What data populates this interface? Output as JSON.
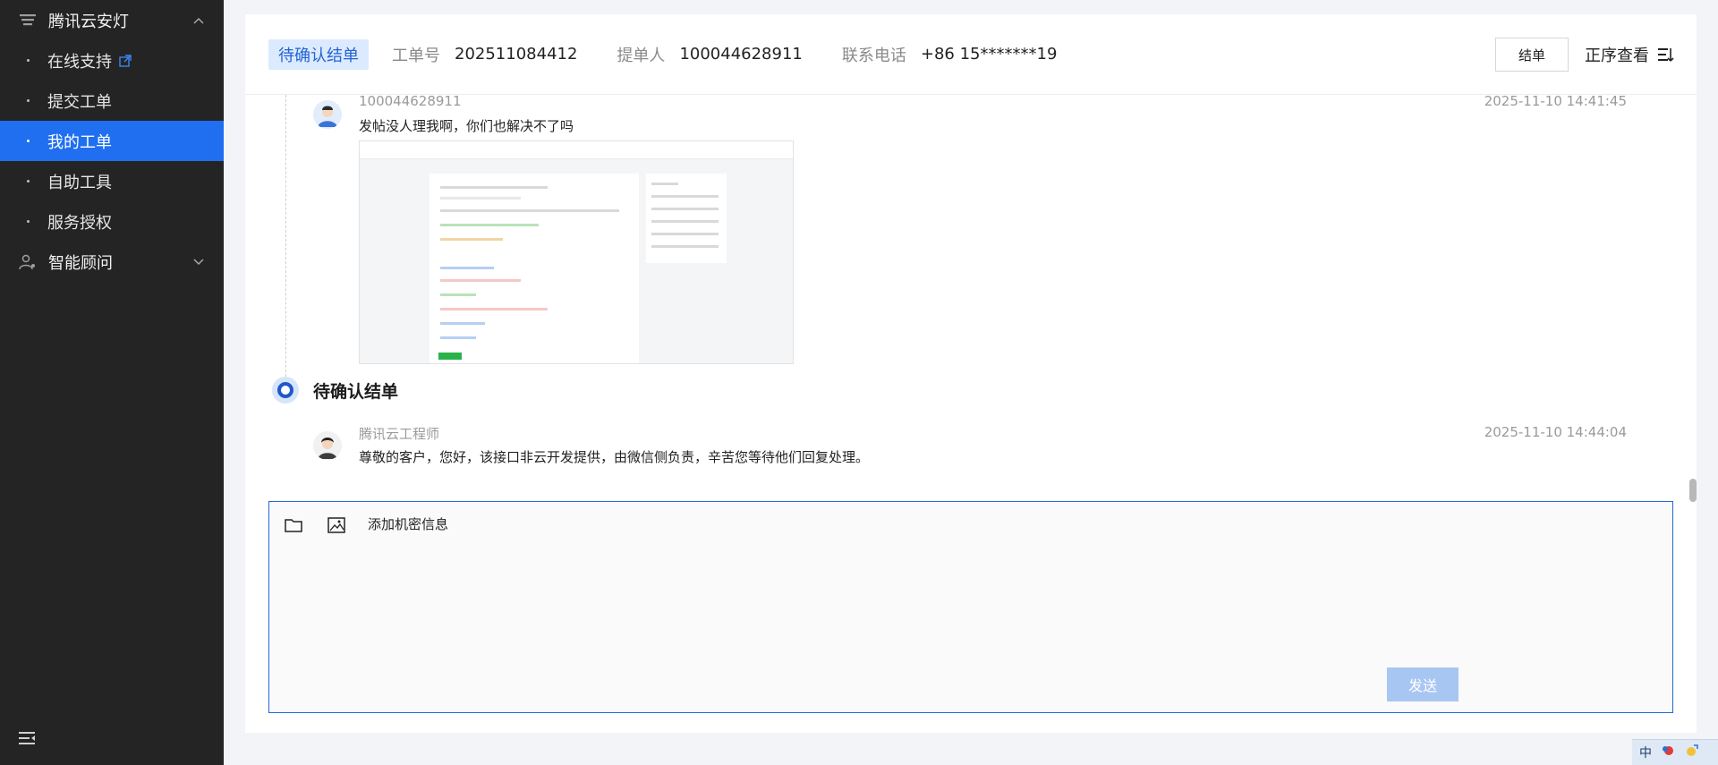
{
  "sidebar": {
    "group1": {
      "label": "腾讯云安灯",
      "icon": "layers-icon",
      "expanded": true
    },
    "items": [
      {
        "label": "在线支持",
        "external": true
      },
      {
        "label": "提交工单"
      },
      {
        "label": "我的工单",
        "active": true
      },
      {
        "label": "自助工具"
      },
      {
        "label": "服务授权"
      }
    ],
    "group2": {
      "label": "智能顾问",
      "icon": "user-settings-icon",
      "expanded": false
    },
    "collapse_icon": "menu-collapse-icon"
  },
  "header": {
    "status": "待确认结单",
    "ticket_label": "工单号",
    "ticket_value": "202511084412",
    "submitter_label": "提单人",
    "submitter_value": "100044628911",
    "phone_label": "联系电话",
    "phone_value": "+86 15*******19",
    "close_button": "结单",
    "order_label": "正序查看"
  },
  "messages": [
    {
      "author": "100044628911",
      "time": "2025-11-10 14:41:45",
      "text": "发帖没人理我啊，你们也解决不了吗",
      "has_attachment": true
    },
    {
      "author": "腾讯云工程师",
      "time": "2025-11-10 14:44:04",
      "text": "尊敬的客户，您好，该接口非云开发提供，由微信侧负责，辛苦您等待他们回复处理。"
    }
  ],
  "status_node": {
    "title": "待确认结单"
  },
  "reply": {
    "secret_label": "添加机密信息",
    "input_value": "",
    "send_label": "发送"
  },
  "ime": {
    "lang": "中"
  },
  "colors": {
    "accent": "#1f6ff0",
    "sidebar_bg": "#242424",
    "tag_bg": "#dceaff",
    "send_disabled": "#a8c6f2"
  }
}
